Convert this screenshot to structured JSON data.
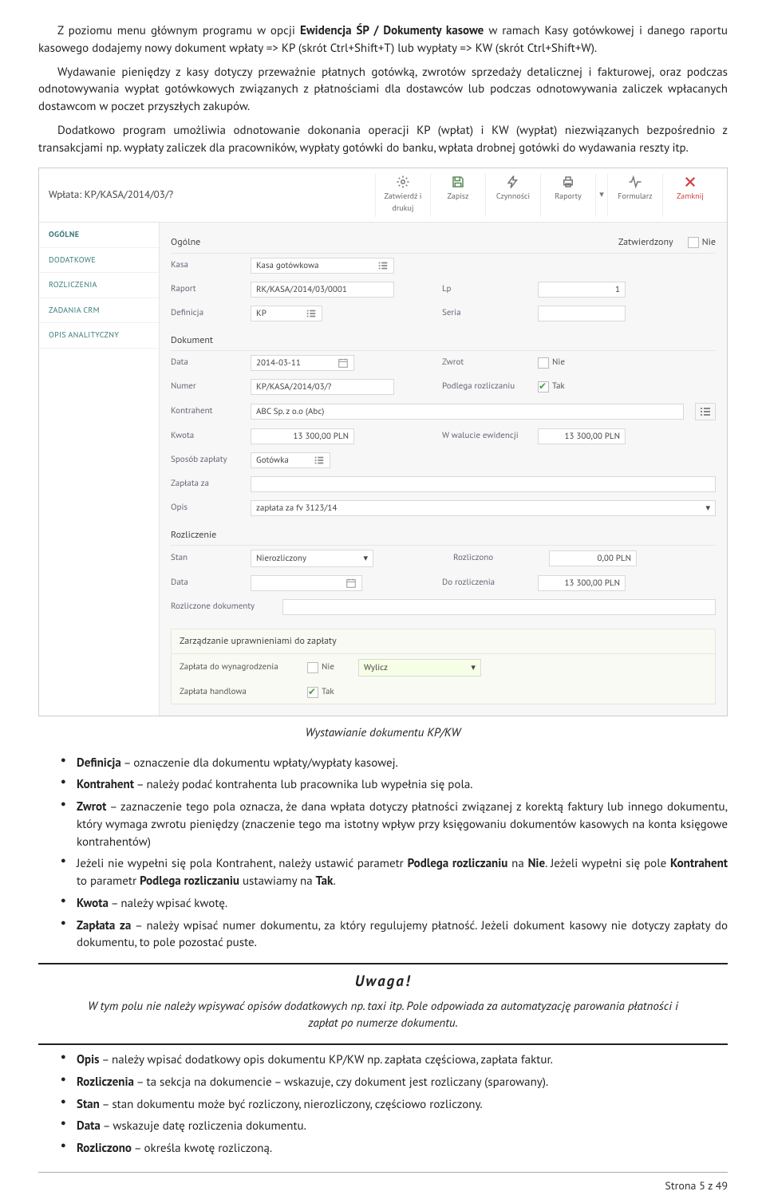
{
  "para1_pre": "Z poziomu menu głównym programu w opcji ",
  "para1_b1": "Ewidencja ŚP / Dokumenty kasowe",
  "para1_post": " w ramach Kasy gotówkowej i danego raportu kasowego dodajemy nowy dokument wpłaty => KP (skrót Ctrl+Shift+T) lub wypłaty => KW (skrót Ctrl+Shift+W).",
  "para2": "Wydawanie pieniędzy z kasy dotyczy przeważnie płatnych gotówką, zwrotów sprzedaży detalicznej i fakturowej, oraz podczas odnotowywania wypłat gotówkowych związanych z płatnościami dla dostawców lub podczas odnotowywania zaliczek wpłacanych dostawcom w poczet przyszłych zakupów.",
  "para3": "Dodatkowo program umożliwia odnotowanie dokonania operacji KP (wpłat) i KW (wypłat) niezwiązanych bezpośrednio z transakcjami np. wypłaty zaliczek dla pracowników, wypłaty gotówki do banku, wpłata drobnej gotówki do wydawania reszty itp.",
  "screenshot": {
    "header_title": "Wpłata: KP/KASA/2014/03/?",
    "toolbar": [
      {
        "label": "Zatwierdź i drukuj",
        "icon": "settings-icon"
      },
      {
        "label": "Zapisz",
        "icon": "save-icon"
      },
      {
        "label": "Czynności",
        "icon": "bolt-icon"
      },
      {
        "label": "Raporty",
        "icon": "print-icon"
      },
      {
        "label": "Formularz",
        "icon": "pulse-icon"
      },
      {
        "label": "Zamknij",
        "icon": "close-icon"
      }
    ],
    "side": [
      "OGÓLNE",
      "DODATKOWE",
      "ROZLICZENIA",
      "ZADANIA CRM",
      "OPIS ANALITYCZNY"
    ],
    "sec_ogolne": "Ogólne",
    "status_label": "Zatwierdzony",
    "status_nie": "Nie",
    "kasa_lab": "Kasa",
    "kasa_val": "Kasa gotówkowa",
    "raport_lab": "Raport",
    "raport_val": "RK/KASA/2014/03/0001",
    "lp_lab": "Lp",
    "lp_val": "1",
    "def_lab": "Definicja",
    "def_val": "KP",
    "seria_lab": "Seria",
    "seria_val": "",
    "sec_dok": "Dokument",
    "data_lab": "Data",
    "data_val": "2014-03-11",
    "zwrot_lab": "Zwrot",
    "zwrot_nie": "Nie",
    "numer_lab": "Numer",
    "numer_val": "KP/KASA/2014/03/?",
    "podlega_lab": "Podlega rozliczaniu",
    "podlega_tak": "Tak",
    "kontr_lab": "Kontrahent",
    "kontr_val": "ABC Sp. z o.o (Abc)",
    "kwota_lab": "Kwota",
    "kwota_val": "13 300,00 PLN",
    "walut_lab": "W walucie ewidencji",
    "walut_val": "13 300,00 PLN",
    "sposob_lab": "Sposób zapłaty",
    "sposob_val": "Gotówka",
    "zaplata_lab": "Zapłata za",
    "zaplata_val": "",
    "opis_lab": "Opis",
    "opis_val": "zapłata za fv 3123/14",
    "sec_roz": "Rozliczenie",
    "stan_lab": "Stan",
    "stan_val": "Nierozliczony",
    "rozlicz_lab": "Rozliczono",
    "rozlicz_val": "0,00 PLN",
    "data2_lab": "Data",
    "data2_val": "",
    "doroz_lab": "Do rozliczenia",
    "doroz_val": "13 300,00 PLN",
    "rozdok_lab": "Rozliczone dokumenty",
    "sec_perm": "Zarządzanie uprawnieniami do zapłaty",
    "zwyn_lab": "Zapłata do wynagrodzenia",
    "zwyn_nie": "Nie",
    "wylicz": "Wylicz",
    "zhand_lab": "Zapłata handlowa",
    "zhand_tak": "Tak"
  },
  "caption": "Wystawianie dokumentu KP/KW",
  "bullets1": {
    "i0_b": "Definicja",
    "i0_t": " – oznaczenie dla dokumentu wpłaty/wypłaty kasowej.",
    "i1_b": "Kontrahent",
    "i1_t": " – należy podać kontrahenta lub pracownika lub wypełnia się pola.",
    "i2_b": "Zwrot",
    "i2_t": " – zaznaczenie tego pola oznacza, że dana wpłata dotyczy płatności związanej z korektą faktury lub innego dokumentu, który wymaga zwrotu pieniędzy (znaczenie tego ma istotny wpływ przy księgowaniu dokumentów kasowych na konta księgowe kontrahentów)",
    "i3_pre": "Jeżeli nie wypełni się pola Kontrahent, należy ustawić parametr ",
    "i3_b1": "Podlega rozliczaniu",
    "i3_mid1": " na ",
    "i3_b2": "Nie",
    "i3_mid2": ". Jeżeli wypełni się pole ",
    "i3_b3": "Kontrahent",
    "i3_mid3": " to parametr ",
    "i3_b4": "Podlega rozliczaniu",
    "i3_mid4": " ustawiamy na ",
    "i3_b5": "Tak",
    "i3_post": ".",
    "i4_b": "Kwota",
    "i4_t": " – należy wpisać kwotę.",
    "i5_b": "Zapłata za",
    "i5_t": " – należy wpisać numer dokumentu, za który regulujemy płatność. Jeżeli dokument kasowy nie dotyczy zapłaty do dokumentu, to pole pozostać puste."
  },
  "uwaga_title": "Uwaga!",
  "uwaga_body": "W tym polu nie należy wpisywać opisów dodatkowych np. taxi itp. Pole odpowiada za automatyzację parowania płatności i zapłat po numerze dokumentu.",
  "bullets2": {
    "i0_b": "Opis",
    "i0_t": " – należy wpisać dodatkowy opis dokumentu KP/KW np. zapłata częściowa, zapłata faktur.",
    "i1_b": "Rozliczenia",
    "i1_t": " – ta sekcja na dokumencie – wskazuje, czy dokument jest rozliczany (sparowany).",
    "i2_b": "Stan",
    "i2_t": " – stan dokumentu może być rozliczony, nierozliczony, częściowo rozliczony.",
    "i3_b": "Data",
    "i3_t": " – wskazuje datę rozliczenia dokumentu.",
    "i4_b": "Rozliczono",
    "i4_t": " – określa kwotę rozliczoną."
  },
  "footer": "Strona 5 z 49"
}
